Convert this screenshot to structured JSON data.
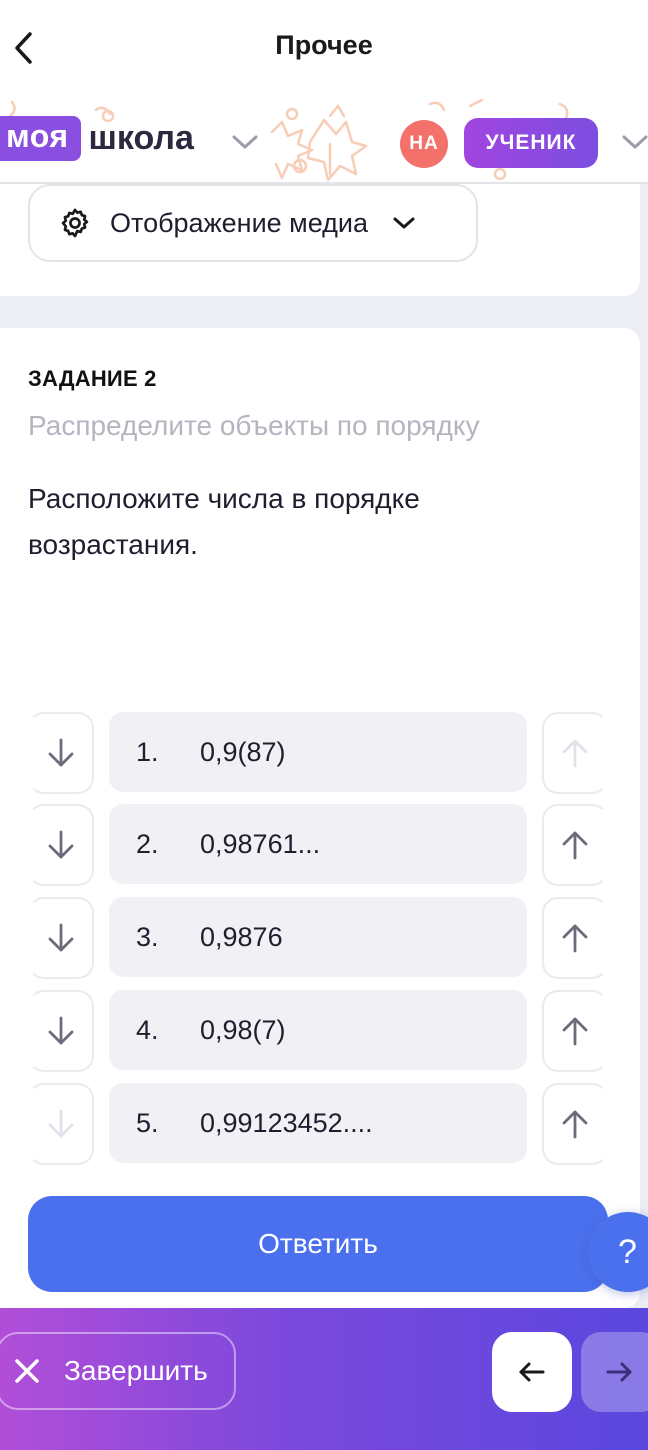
{
  "header": {
    "title": "Прочее"
  },
  "brand": {
    "logo_part1": "моя",
    "logo_part2": "школа"
  },
  "user": {
    "initials": "НА",
    "role": "УЧЕНИК"
  },
  "media": {
    "label": "Отображение медиа"
  },
  "task": {
    "title": "ЗАДАНИЕ 2",
    "subtitle": "Распределите объекты по порядку",
    "text": "Расположите числа в порядке возрастания.",
    "items": [
      {
        "num": "1.",
        "value": "0,9(87)",
        "down_enabled": true,
        "up_enabled": false
      },
      {
        "num": "2.",
        "value": "0,98761...",
        "down_enabled": true,
        "up_enabled": true
      },
      {
        "num": "3.",
        "value": "0,9876",
        "down_enabled": true,
        "up_enabled": true
      },
      {
        "num": "4.",
        "value": "0,98(7)",
        "down_enabled": true,
        "up_enabled": true
      },
      {
        "num": "5.",
        "value": "0,99123452....",
        "down_enabled": false,
        "up_enabled": true
      }
    ],
    "answer_label": "Ответить"
  },
  "help": {
    "label": "?"
  },
  "footer": {
    "finish_label": "Завершить"
  },
  "icons": {
    "back": "chevron-left-icon",
    "gear": "gear-icon",
    "dropdown": "chevron-down-icon",
    "move_down": "arrow-down-icon",
    "move_up": "arrow-up-icon",
    "close": "close-icon",
    "prev": "arrow-left-icon",
    "next": "arrow-right-icon"
  },
  "colors": {
    "accent": "#4a70ee",
    "brand_purple": "#8a4fe0",
    "badge_red": "#f3706b",
    "footer_gradient_start": "#b14ed8",
    "footer_gradient_end": "#5b47de"
  }
}
